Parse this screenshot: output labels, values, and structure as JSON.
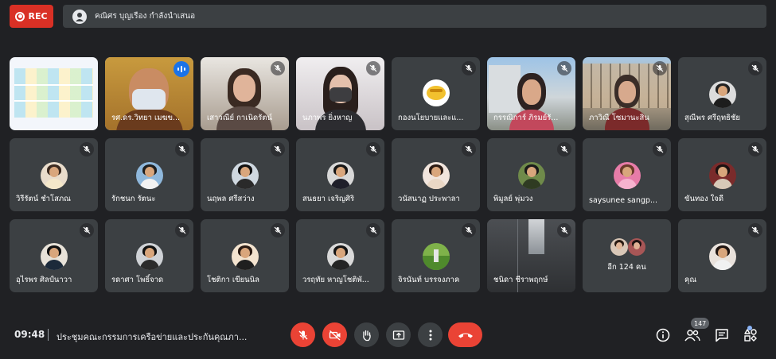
{
  "recording": {
    "label": "REC"
  },
  "presenter_bar": {
    "text": "คณิศร บุญเรือง กำลังนำเสนอ"
  },
  "tiles": [
    {
      "name": "",
      "speaking": false
    },
    {
      "name": "รศ.ดร.วิทยา เมฆข...",
      "speaking": true
    },
    {
      "name": "เสาวณีย์ กาเนิดรัตน์",
      "speaking": false
    },
    {
      "name": "นภาพร ยิ่งหาญ",
      "speaking": false
    },
    {
      "name": "กองนโยบายและแ...",
      "speaking": false
    },
    {
      "name": "กรรณิการ์ ภิรมย์รั...",
      "speaking": false
    },
    {
      "name": "ภาวิณี โซมานะสิน",
      "speaking": false
    },
    {
      "name": "สุณีพร ศรีฤทธิชัย",
      "speaking": false
    },
    {
      "name": "วิรีรัตน์ ชำโสภณ",
      "speaking": false
    },
    {
      "name": "รักชนก รัตนะ",
      "speaking": false
    },
    {
      "name": "นฤพล ศรีสว่าง",
      "speaking": false
    },
    {
      "name": "สนธยา เจริญศิริ",
      "speaking": false
    },
    {
      "name": "วนัสนาฏ ประพาลา",
      "speaking": false
    },
    {
      "name": "พิมูลย์ พุ่มวง",
      "speaking": false
    },
    {
      "name": "saysunee sangp...",
      "speaking": false
    },
    {
      "name": "ขันทอง ใจดี",
      "speaking": false
    },
    {
      "name": "อุไรพร ศิลป์นาวา",
      "speaking": false
    },
    {
      "name": "รดาศา โพธิ์จาด",
      "speaking": false
    },
    {
      "name": "โชติกา เขียนนิล",
      "speaking": false
    },
    {
      "name": "วรฤทัย หาญโชติพั...",
      "speaking": false
    },
    {
      "name": "จิรนันท์ บรรจงภาค",
      "speaking": false
    },
    {
      "name": "ชนิดา ชีราพฤกษ์",
      "speaking": false
    },
    {
      "name": "อีก 124 คน",
      "speaking": false
    },
    {
      "name": "คุณ",
      "speaking": false
    }
  ],
  "bottom_bar": {
    "time": "09:48",
    "meeting_title": "ประชุมคณะกรรมการเครือข่ายและประกันคุณภา...",
    "participants_count": "147"
  },
  "colors": {
    "background": "#202124",
    "tile": "#3c4043",
    "danger": "#ea4335",
    "speaking": "#8ab4f8"
  }
}
